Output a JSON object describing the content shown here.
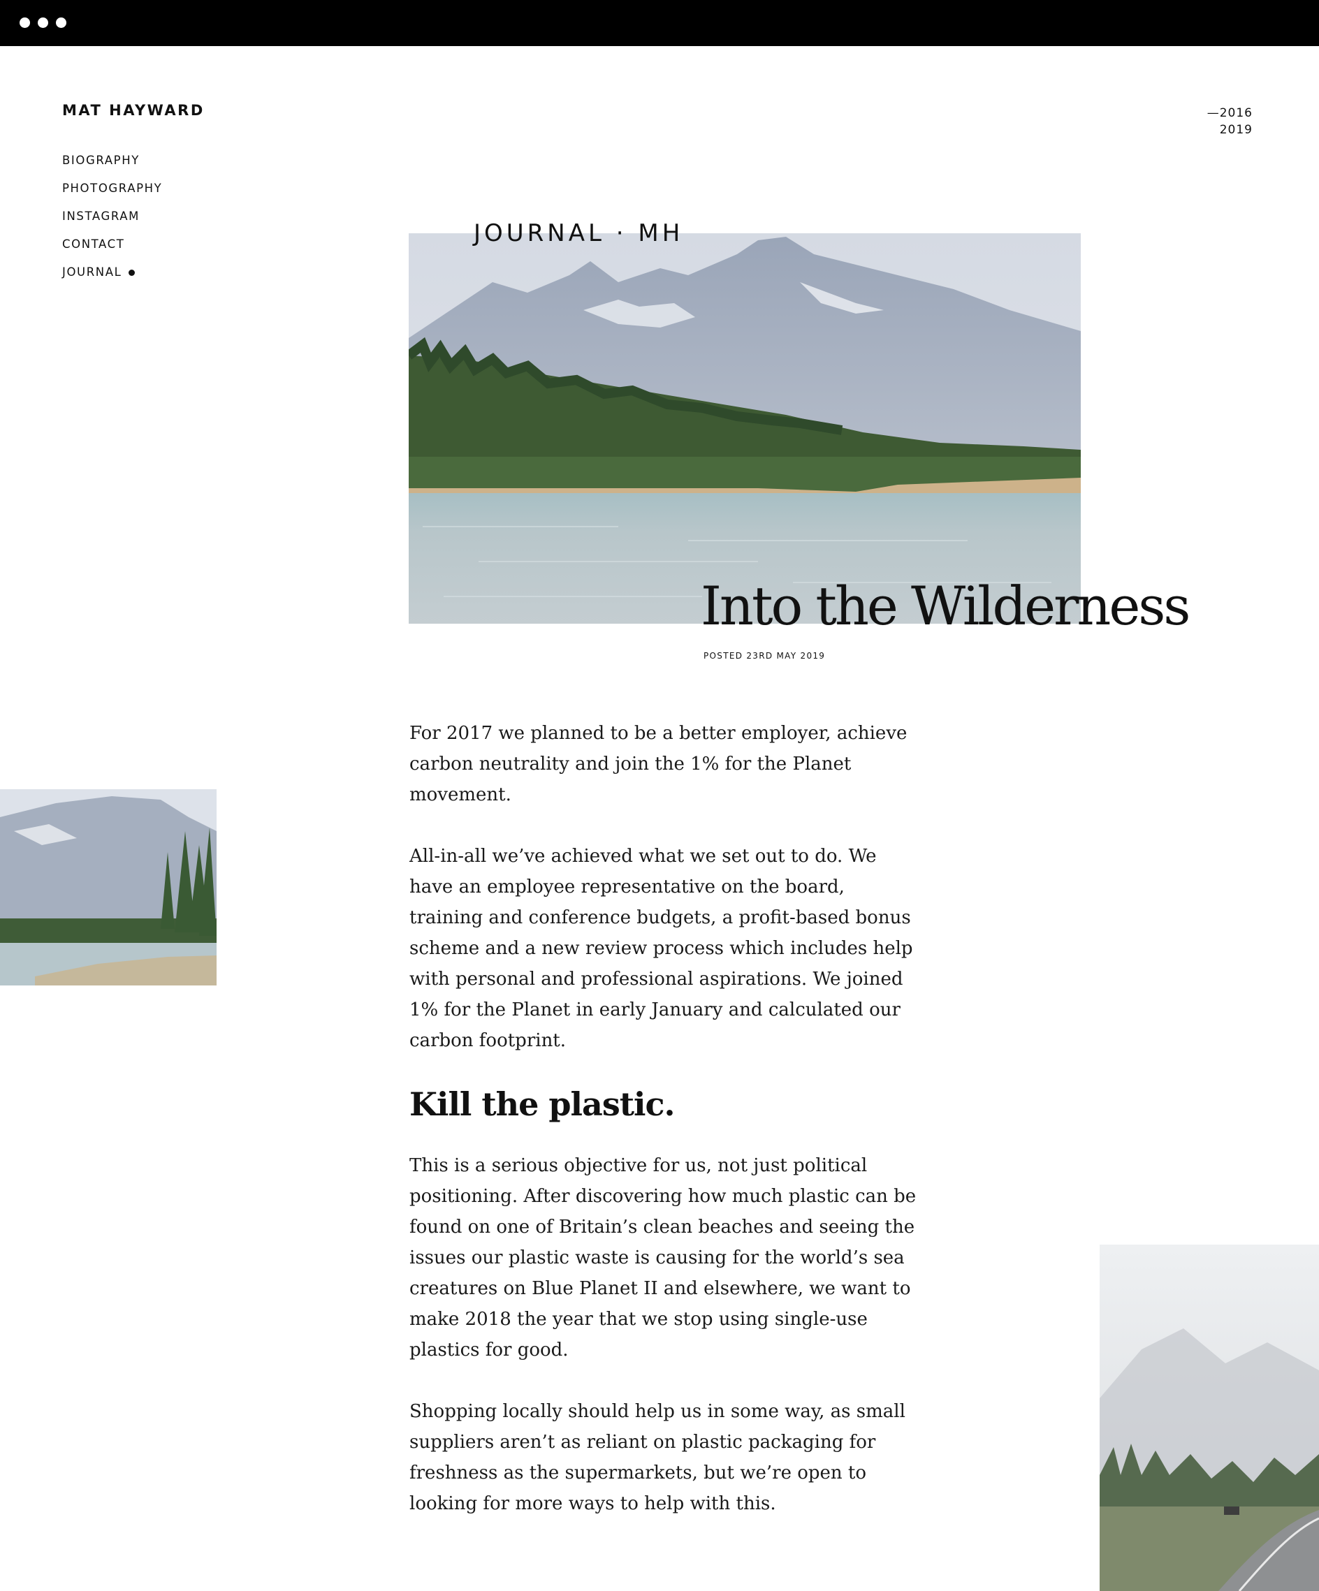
{
  "window": {
    "controls": [
      "dot",
      "dot",
      "dot"
    ]
  },
  "brand": {
    "name": "MAT HAYWARD"
  },
  "nav": {
    "items": [
      {
        "label": "BIOGRAPHY"
      },
      {
        "label": "PHOTOGRAPHY"
      },
      {
        "label": "INSTAGRAM"
      },
      {
        "label": "CONTACT"
      },
      {
        "label": "JOURNAL"
      }
    ],
    "active": "JOURNAL"
  },
  "years": {
    "dash": "—",
    "start": "2016",
    "end": "2019"
  },
  "hero": {
    "mark": "JOURNAL · MH",
    "image": "mountain-lake-forest-photo"
  },
  "post": {
    "title": "Into the Wilderness",
    "posted": "POSTED 23RD MAY 2019"
  },
  "article": {
    "p1": "For 2017 we planned to be a better employer, achieve carbon neutrality and join the 1% for the Planet movement.",
    "p2": "All-in-all we’ve achieved what we set out to do. We have an employee representative on the board, training and conference budgets, a profit-based bonus scheme and a new review process which includes help with personal and professional aspirations. We joined 1% for the Planet in early January and calculated our carbon footprint.",
    "subhead": "Kill the plastic.",
    "p3": "This is a serious objective for us, not just political positioning. After discovering how much plastic can be found on one of Britain’s clean beaches and seeing the issues our plastic waste is causing for the world’s sea creatures on Blue Planet II and elsewhere, we want to make 2018 the year that we stop using single-use plastics for good.",
    "p4": "Shopping locally should help us in some way, as small suppliers aren’t as reliant on plastic packaging for freshness as the supermarkets, but we’re open to looking for more ways to help with this."
  },
  "images": {
    "left": "lake-shore-photo",
    "right": "misty-road-photo"
  },
  "colors": {
    "text": "#111111",
    "background": "#ffffff",
    "topbar": "#000000"
  }
}
